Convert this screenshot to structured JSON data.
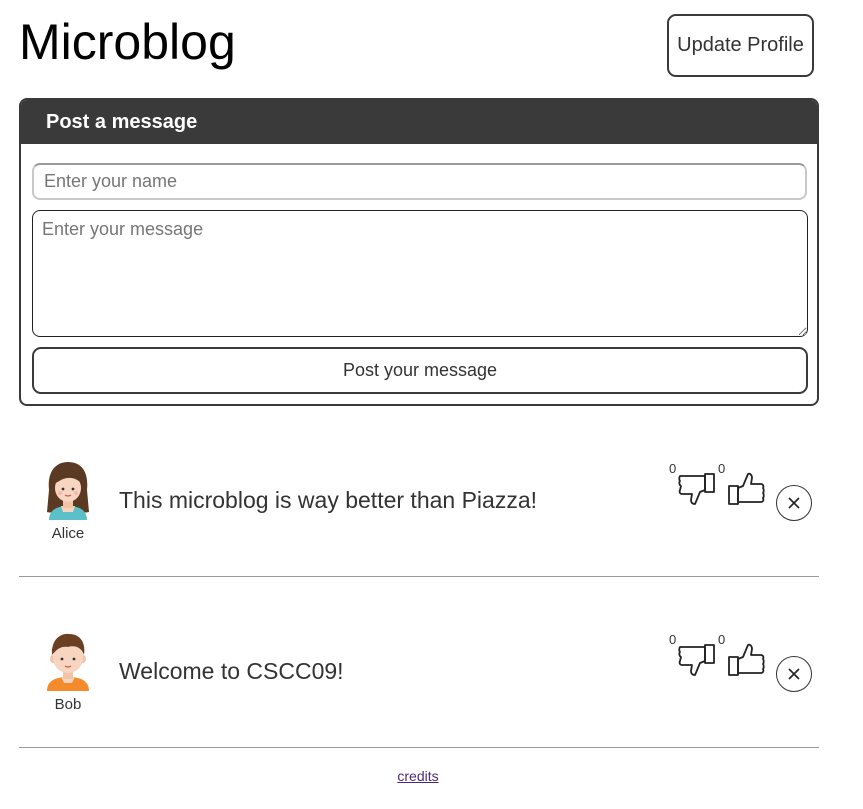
{
  "header": {
    "title": "Microblog",
    "update_profile_label": "Update Profile"
  },
  "composer": {
    "heading": "Post a message",
    "name_placeholder": "Enter your name",
    "name_value": "",
    "message_placeholder": "Enter your message",
    "message_value": "",
    "submit_label": "Post your message"
  },
  "posts": [
    {
      "author": "Alice",
      "avatar_icon": "girl-avatar-icon",
      "text": "This microblog is way better than Piazza!",
      "dislikes": "0",
      "likes": "0"
    },
    {
      "author": "Bob",
      "avatar_icon": "boy-avatar-icon",
      "text": "Welcome to CSCC09!",
      "dislikes": "0",
      "likes": "0"
    }
  ],
  "footer": {
    "credits_label": "credits"
  },
  "colors": {
    "panel_header_bg": "#3a3a3a",
    "border": "#3a3a3a",
    "link": "#4b2a7a"
  }
}
